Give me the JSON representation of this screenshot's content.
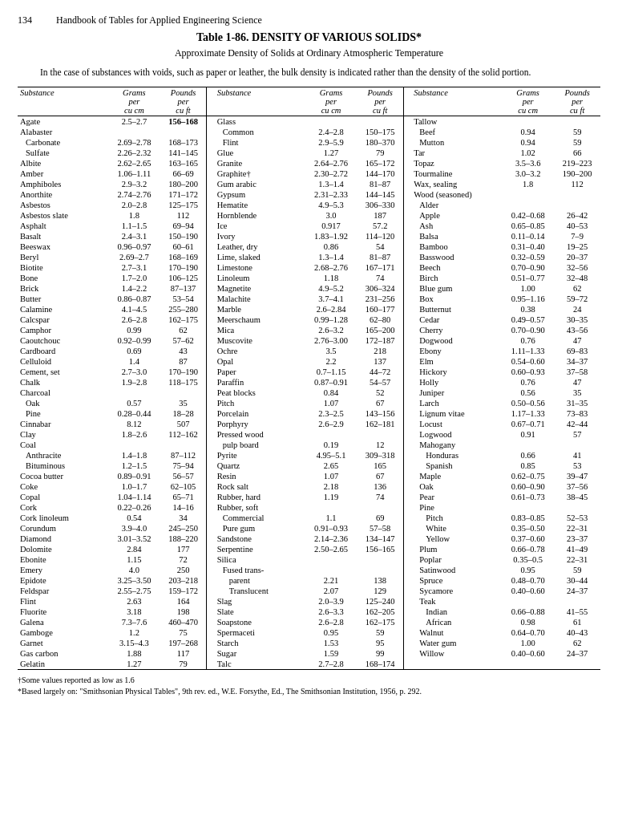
{
  "header": {
    "page_number": "134",
    "book_title": "Handbook of Tables for Applied Engineering Science"
  },
  "title": "Table 1-86.  DENSITY OF VARIOUS SOLIDS*",
  "subtitle": "Approximate Density of Solids at Ordinary Atmospheric Temperature",
  "intro": "In the case of substances with voids, such as paper or leather, the bulk density is indicated rather than the density of the solid portion.",
  "col_headers": {
    "substance": "Substance",
    "grams": "Grams\nper\ncu cm",
    "pounds": "Pounds\nper\ncu ft"
  },
  "footnotes": [
    "†Some values reported as low as 1.6",
    "*Based largely on: \"Smithsonian Physical Tables\", 9th rev. ed., W.E. Forsythe, Ed., The Smithsonian Institution, 1956, p. 292."
  ]
}
